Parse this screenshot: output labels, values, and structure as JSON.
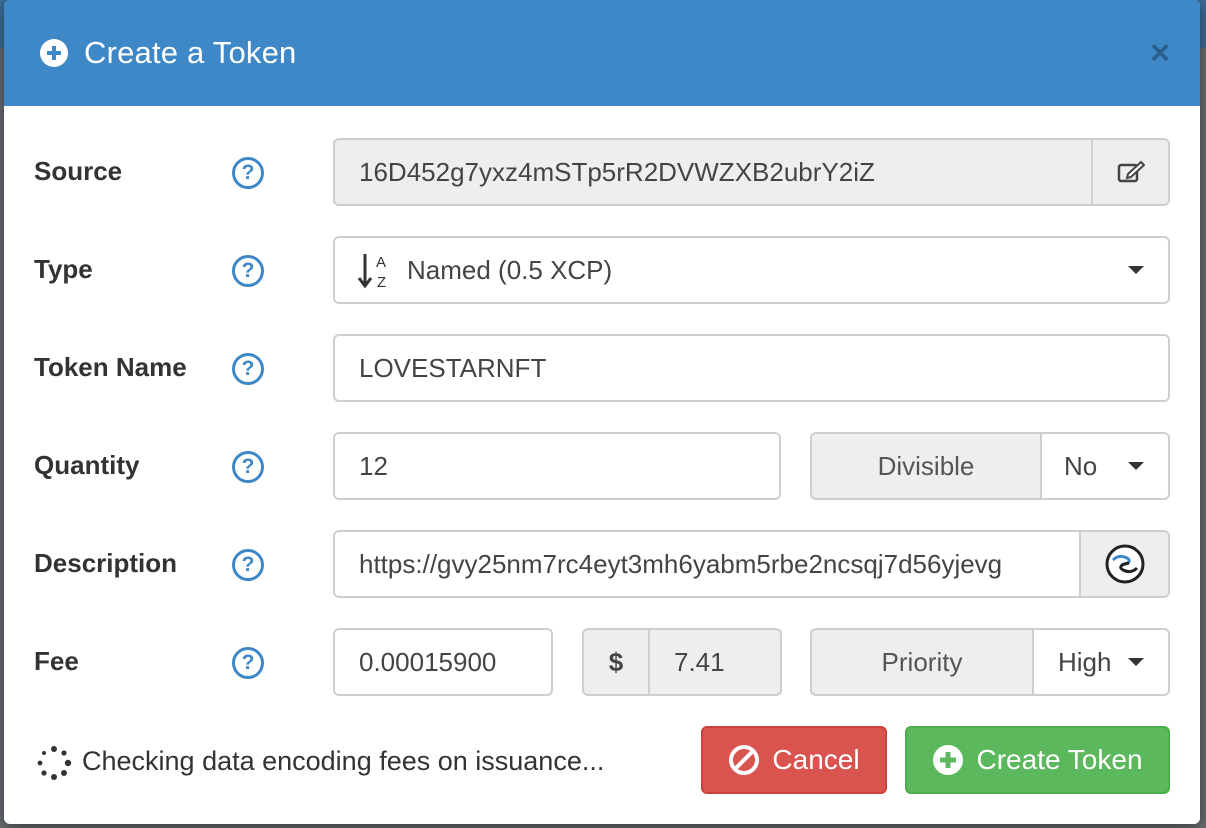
{
  "dialog": {
    "title": "Create a Token",
    "close_label": "×"
  },
  "form": {
    "source": {
      "label": "Source",
      "value": "16D452g7yxz4mSTp5rR2DVWZXB2ubrY2iZ",
      "edit_icon": "edit-icon"
    },
    "type": {
      "label": "Type",
      "value": "Named (0.5 XCP)",
      "icon": "sort-alpha-icon"
    },
    "token_name": {
      "label": "Token Name",
      "value": "LOVESTARNFT"
    },
    "quantity": {
      "label": "Quantity",
      "value": "12",
      "divisible_label": "Divisible",
      "divisible_value": "No"
    },
    "description": {
      "label": "Description",
      "value": "https://gvy25nm7rc4eyt3mh6yabm5rbe2ncsqj7d56yjevg",
      "icon": "link-icon"
    },
    "fee": {
      "label": "Fee",
      "value": "0.00015900",
      "currency_symbol": "$",
      "usd_value": "7.41",
      "priority_label": "Priority",
      "priority_value": "High"
    },
    "help_glyph": "?"
  },
  "footer": {
    "status_text": "Checking data encoding fees on issuance...",
    "cancel_label": "Cancel",
    "create_label": "Create Token"
  },
  "colors": {
    "header_bg": "#3f88c7",
    "cancel_bg": "#d9534f",
    "create_bg": "#5cb85c"
  }
}
